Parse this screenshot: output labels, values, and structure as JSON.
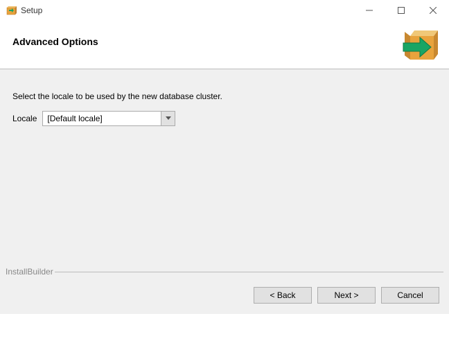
{
  "window": {
    "title": "Setup"
  },
  "header": {
    "title": "Advanced Options"
  },
  "content": {
    "instruction": "Select the locale to be used by the new database cluster.",
    "locale_label": "Locale",
    "locale_value": "[Default locale]"
  },
  "footer": {
    "brand": "InstallBuilder",
    "back_label": "< Back",
    "next_label": "Next >",
    "cancel_label": "Cancel"
  }
}
